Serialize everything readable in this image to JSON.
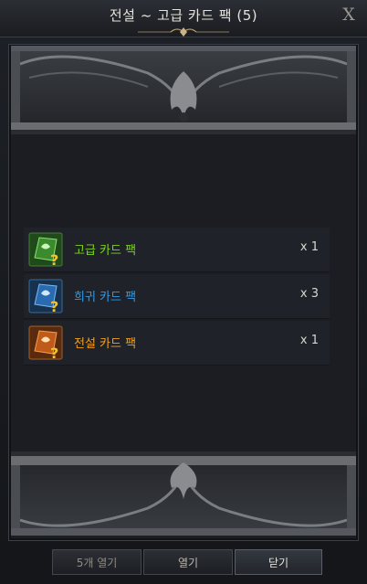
{
  "window": {
    "title": "전설 ~ 고급 카드 팩 (5)",
    "close_symbol": "X"
  },
  "items": [
    {
      "name": "고급 카드 팩",
      "qty": "x 1",
      "name_color": "#7ed321",
      "icon": "card-pack-uncommon-icon"
    },
    {
      "name": "희귀 카드 팩",
      "qty": "x 3",
      "name_color": "#2f9be8",
      "icon": "card-pack-rare-icon"
    },
    {
      "name": "전설 카드 팩",
      "qty": "x 1",
      "name_color": "#f0a020",
      "icon": "card-pack-legendary-icon"
    }
  ],
  "buttons": {
    "open5": "5개 열기",
    "open": "열기",
    "close": "닫기"
  }
}
